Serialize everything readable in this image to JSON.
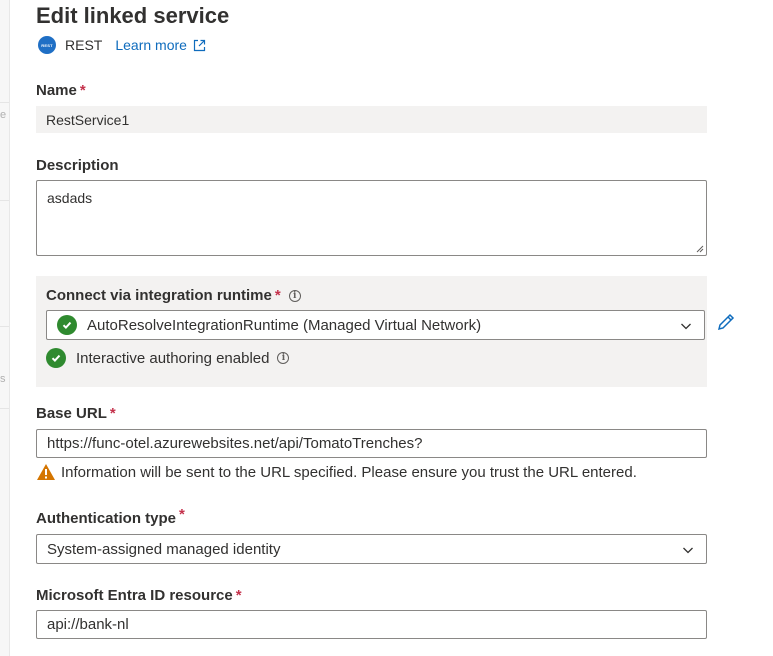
{
  "panel": {
    "title": "Edit linked service",
    "service_type": "REST",
    "service_icon_text": "REST",
    "learn_more": "Learn more"
  },
  "name": {
    "label": "Name",
    "required_mark": "*",
    "value": "RestService1"
  },
  "description": {
    "label": "Description",
    "value": "asdads"
  },
  "integration_runtime": {
    "label": "Connect via integration runtime",
    "required_mark": "*",
    "selected": "AutoResolveIntegrationRuntime (Managed Virtual Network)",
    "interactive_status": "Interactive authoring enabled"
  },
  "base_url": {
    "label": "Base URL",
    "required_mark": "*",
    "value": "https://func-otel.azurewebsites.net/api/TomatoTrenches?",
    "warning": "Information will be sent to the URL specified. Please ensure you trust the URL entered."
  },
  "authentication": {
    "label": "Authentication type",
    "required_mark": "*",
    "selected": "System-assigned managed identity"
  },
  "entra_resource": {
    "label": "Microsoft Entra ID resource",
    "required_mark": "*",
    "value": "api://bank-nl"
  },
  "background_fragments": [
    "e",
    "s"
  ],
  "colors": {
    "link": "#0f6cbd",
    "required": "#c4314b",
    "success": "#2f8a2f",
    "warning": "#d47500",
    "panel_bg": "#f3f2f1"
  },
  "icons": [
    "rest-service-icon",
    "external-link-icon",
    "info-icon",
    "check-circle-icon",
    "chevron-down-icon",
    "edit-pencil-icon",
    "warning-icon"
  ]
}
